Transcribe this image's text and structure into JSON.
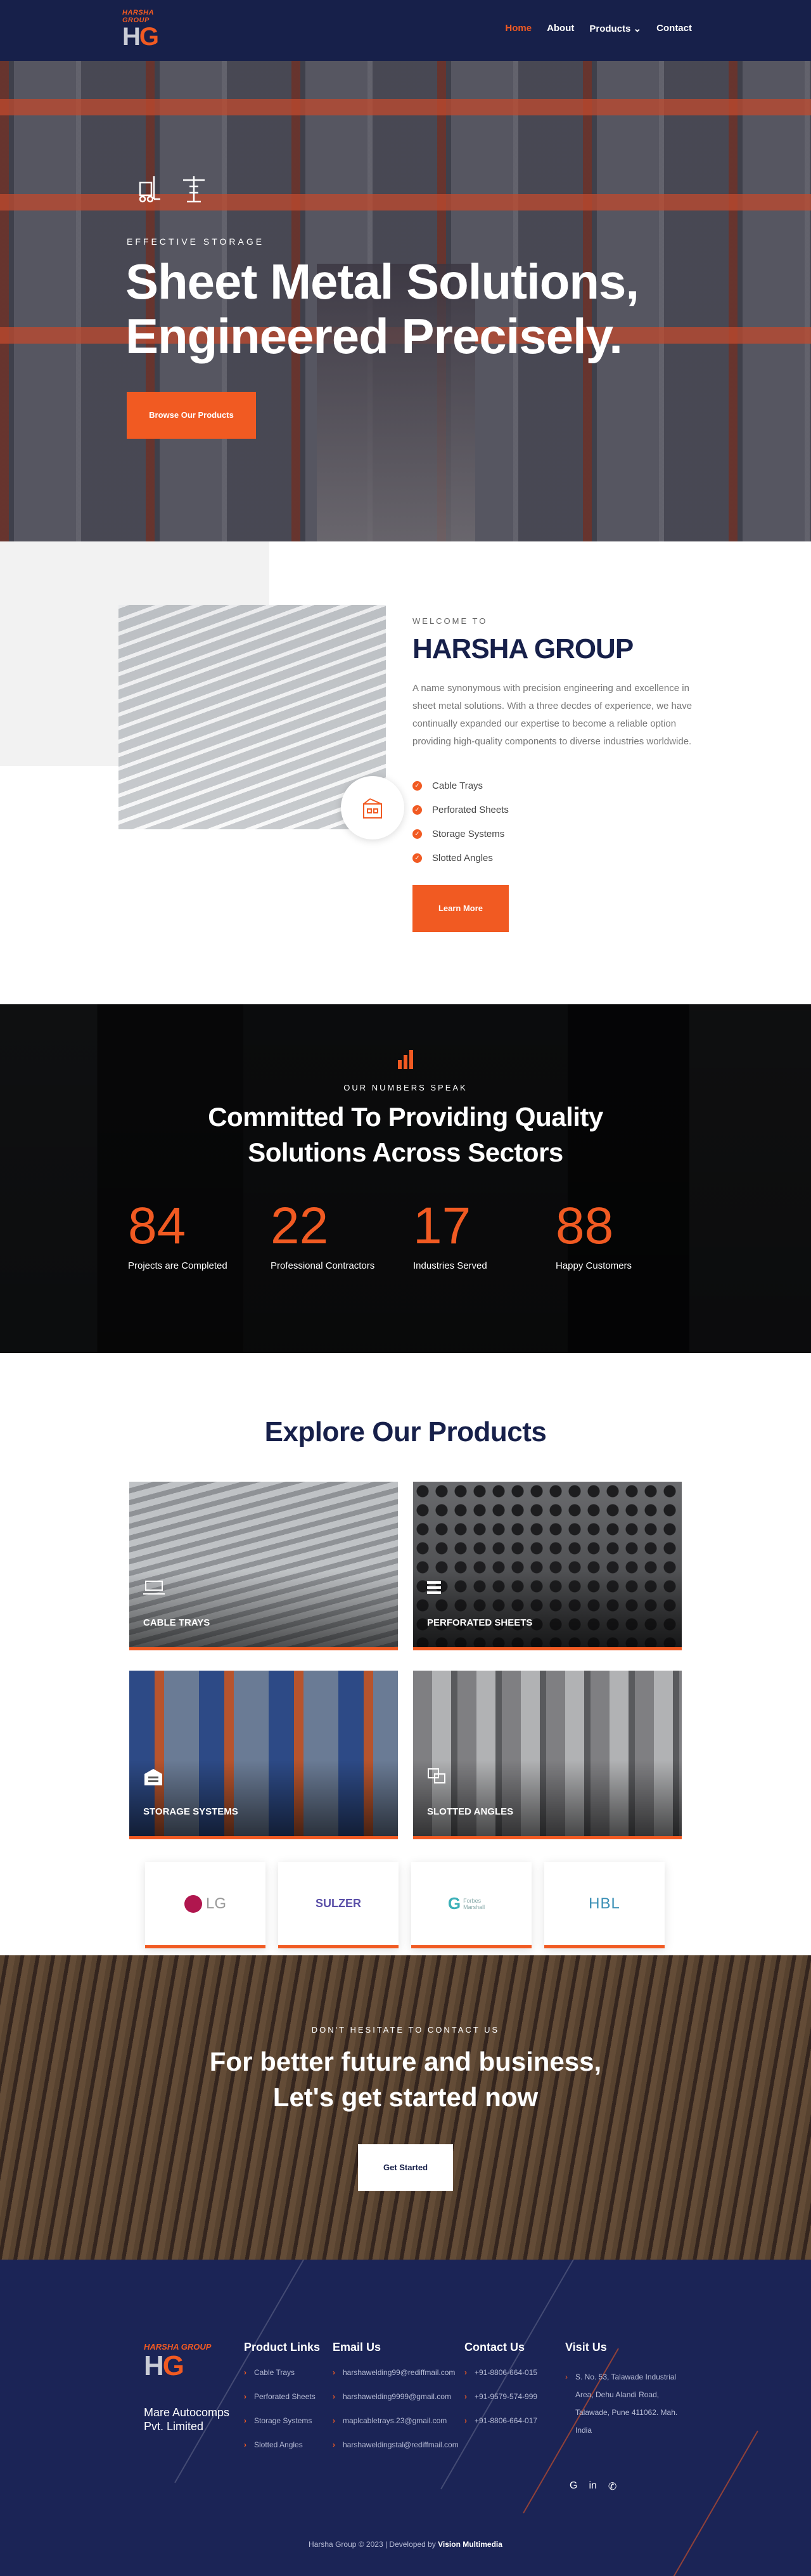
{
  "nav": {
    "logo_brand": "HARSHA GROUP",
    "logo_mark_h": "H",
    "logo_mark_g": "G",
    "items": [
      {
        "label": "Home"
      },
      {
        "label": "About"
      },
      {
        "label": "Products"
      },
      {
        "label": "Contact"
      }
    ],
    "dropdown_icon": "chevron-down-icon"
  },
  "hero": {
    "eyebrow": "EFFECTIVE STORAGE",
    "title_line1": "Sheet Metal Solutions,",
    "title_line2": "Engineered Precisely.",
    "button": "Browse Our Products"
  },
  "about": {
    "eyebrow": "WELCOME TO",
    "title": "HARSHA GROUP",
    "description": "A name synonymous with precision engineering and excellence in sheet metal solutions. With a three decdes of experience, we have continually expanded our expertise to become a reliable option providing high-quality components to diverse industries worldwide.",
    "features": [
      "Cable Trays",
      "Perforated Sheets",
      "Storage Systems",
      "Slotted Angles"
    ],
    "button": "Learn More"
  },
  "stats": {
    "eyebrow": "OUR NUMBERS SPEAK",
    "title_line1": "Committed To Providing Quality",
    "title_line2": "Solutions Across Sectors",
    "items": [
      {
        "value": "84",
        "label": "Projects are Completed"
      },
      {
        "value": "22",
        "label": "Professional Contractors"
      },
      {
        "value": "17",
        "label": "Industries Served"
      },
      {
        "value": "88",
        "label": "Happy Customers"
      }
    ]
  },
  "products": {
    "title": "Explore Our Products",
    "cards": [
      {
        "label": "CABLE TRAYS"
      },
      {
        "label": "PERFORATED SHEETS"
      },
      {
        "label": "STORAGE SYSTEMS"
      },
      {
        "label": "SLOTTED ANGLES"
      }
    ],
    "clients": [
      "LG",
      "SULZER",
      "Forbes Marshall",
      "HBL"
    ]
  },
  "cta": {
    "eyebrow": "DON'T HESITATE TO CONTACT US",
    "title_line1": "For better future and business,",
    "title_line2": "Let's get started now",
    "button": "Get Started"
  },
  "footer": {
    "logo_brand": "HARSHA GROUP",
    "logo_mark_h": "H",
    "logo_mark_g": "G",
    "company": "Mare Autocomps Pvt. Limited",
    "product_links": {
      "title": "Product Links",
      "items": [
        "Cable Trays",
        "Perforated Sheets",
        "Storage Systems",
        "Slotted Angles"
      ]
    },
    "email": {
      "title": "Email Us",
      "items": [
        "harshawelding99@rediffmail.com",
        "harshawelding9999@gmail.com",
        "maplcabletrays.23@gmail.com",
        "harshaweldingstal@rediffmail.com"
      ]
    },
    "contact": {
      "title": "Contact Us",
      "items": [
        "+91-8806-664-015",
        "+91-9579-574-999",
        "+91-8806-664-017"
      ]
    },
    "visit": {
      "title": "Visit Us",
      "address": "S. No. 53, Talawade Industrial Area, Dehu Alandi Road, Talawade, Pune 411062. Mah. India"
    },
    "social_icons": [
      "google-icon",
      "linkedin-icon",
      "whatsapp-icon"
    ],
    "copyright": "Harsha Group © 2023 | Developed by",
    "developer": "Vision Multimedia"
  }
}
